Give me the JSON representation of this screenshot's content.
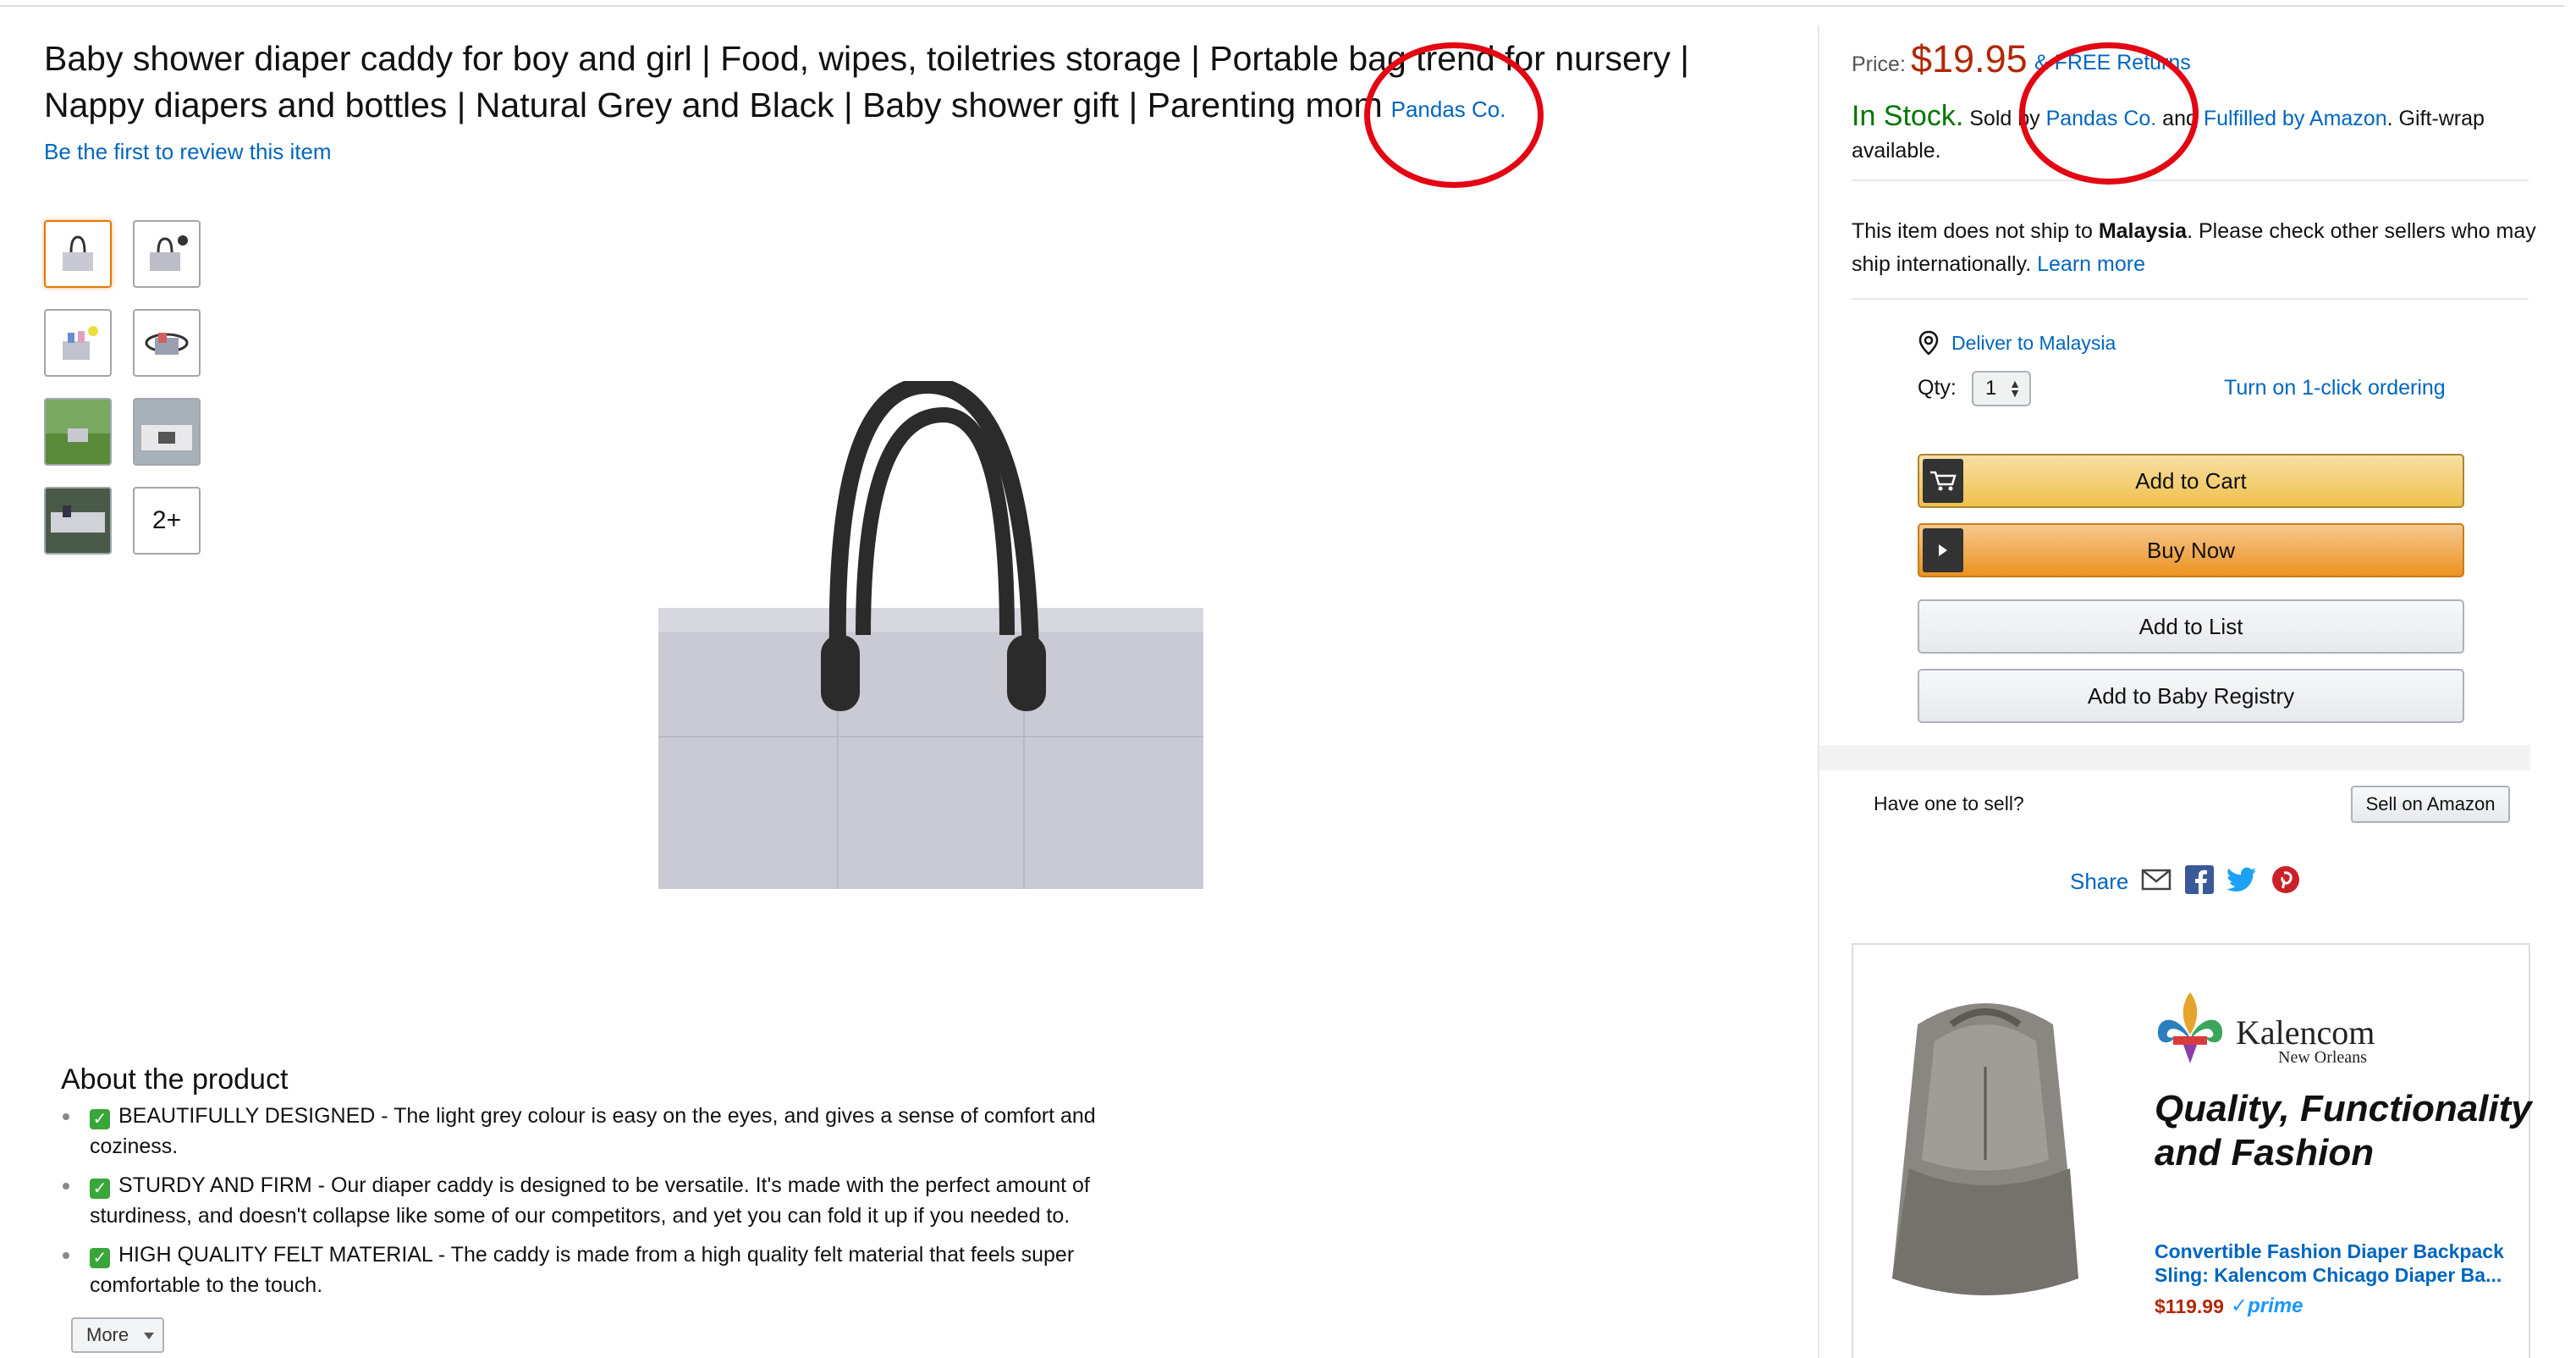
{
  "product": {
    "title": "Baby shower diaper caddy for boy and girl | Food, wipes, toiletries storage | Portable bag trend for nursery | Nappy diapers and bottles | Natural Grey and Black | Baby shower gift | Parenting mom",
    "brand": "Pandas Co.",
    "review_prompt": "Be the first to review this item"
  },
  "thumbnails": {
    "more_label": "2+"
  },
  "about": {
    "heading": "About the product",
    "bullets": [
      "BEAUTIFULLY DESIGNED - The light grey colour is easy on the eyes, and gives a sense of comfort and coziness.",
      "STURDY AND FIRM - Our diaper caddy is designed to be versatile. It's made with the perfect amount of sturdiness, and doesn't collapse like some of our competitors, and yet you can fold it up if you needed to.",
      "HIGH QUALITY FELT MATERIAL - The caddy is made from a high quality felt material that feels super comfortable to the touch."
    ],
    "more_button": "More"
  },
  "buybox": {
    "price_label": "Price:",
    "price": "$19.95",
    "free_returns": "& FREE Returns",
    "in_stock": "In Stock.",
    "sold_by": "Sold by",
    "seller": "Pandas Co.",
    "and": "and",
    "fulfilled": "Fulfilled by Amazon",
    "giftwrap": ". Gift-wrap available.",
    "noship_pre": "This item does not ship to",
    "noship_country": "Malaysia",
    "noship_post": ". Please check other sellers who may ship internationally.",
    "learn_more": "Learn more",
    "deliver_to": "Deliver to Malaysia",
    "qty_label": "Qty:",
    "qty_value": "1",
    "one_click": "Turn on 1-click ordering",
    "add_to_cart": "Add to Cart",
    "buy_now": "Buy Now",
    "add_to_list": "Add to List",
    "add_to_registry": "Add to Baby Registry",
    "have_one": "Have one to sell?",
    "sell_on_amazon": "Sell on Amazon",
    "share": "Share"
  },
  "ad": {
    "logo_name": "Kalencom",
    "logo_sub": "New Orleans",
    "headline": "Quality, Functionality and Fashion",
    "product": "Convertible Fashion Diaper Backpack Sling: Kalencom Chicago Diaper Ba...",
    "price": "$119.99",
    "prime": "prime"
  },
  "colors": {
    "price": "#b12704",
    "link": "#0066c0",
    "in_stock": "#007600",
    "annotation": "#e30613"
  }
}
